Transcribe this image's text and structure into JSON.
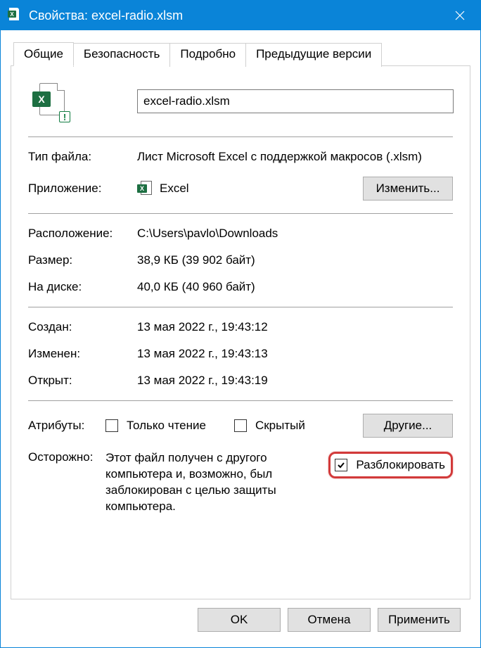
{
  "title": "Свойства: excel-radio.xlsm",
  "tabs": {
    "general": "Общие",
    "security": "Безопасность",
    "details": "Подробно",
    "previous": "Предыдущие версии"
  },
  "filename": "excel-radio.xlsm",
  "labels": {
    "filetype": "Тип файла:",
    "application": "Приложение:",
    "location": "Расположение:",
    "size": "Размер:",
    "ondisk": "На диске:",
    "created": "Создан:",
    "modified": "Изменен:",
    "opened": "Открыт:",
    "attributes": "Атрибуты:",
    "caution": "Осторожно:"
  },
  "values": {
    "filetype": "Лист Microsoft Excel с поддержкой макросов (.xlsm)",
    "app": "Excel",
    "location": "C:\\Users\\pavlo\\Downloads",
    "size": "38,9 КБ (39 902 байт)",
    "ondisk": "40,0 КБ (40 960 байт)",
    "created": "13 мая 2022 г., 19:43:12",
    "modified": "13 мая 2022 г., 19:43:13",
    "opened": "13 мая 2022 г., 19:43:19"
  },
  "attributes": {
    "readonly": "Только чтение",
    "hidden": "Скрытый"
  },
  "caution_text": "Этот файл получен с другого компьютера и, возможно, был заблокирован с целью защиты компьютера.",
  "buttons": {
    "change": "Изменить...",
    "other": "Другие...",
    "unblock": "Разблокировать",
    "ok": "OK",
    "cancel": "Отмена",
    "apply": "Применить"
  },
  "checked": {
    "readonly": false,
    "hidden": false,
    "unblock": true
  }
}
